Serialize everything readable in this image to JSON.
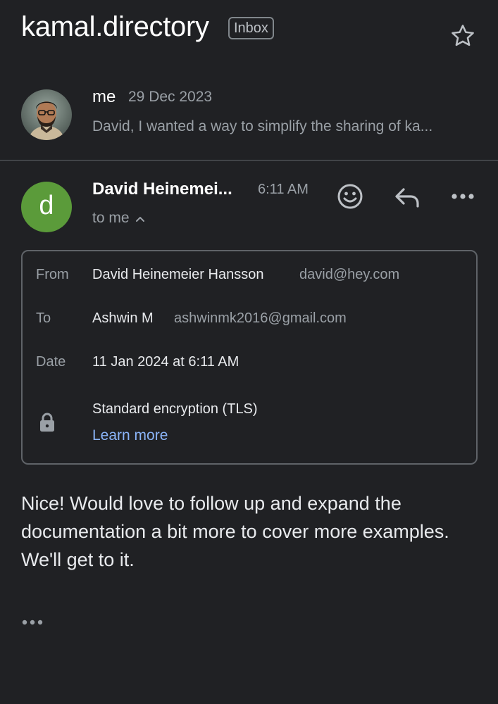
{
  "thread": {
    "subject": "kamal.directory",
    "label_badge": "Inbox",
    "star_icon": "star-outline-icon"
  },
  "previous_message": {
    "sender": "me",
    "date": "29 Dec 2023",
    "snippet": "David, I wanted a way to simplify the sharing of ka..."
  },
  "message": {
    "avatar_letter": "d",
    "avatar_color": "#5b9b3a",
    "sender": "David Heinemei...",
    "time": "6:11 AM",
    "to": "to me",
    "actions": [
      "emoji-react-icon",
      "reply-icon",
      "more-options-icon"
    ],
    "details": {
      "from_label": "From",
      "from_name": "David Heinemeier Hansson",
      "from_email": "david@hey.com",
      "to_label": "To",
      "to_name": "Ashwin M",
      "to_email": "ashwinmk2016@gmail.com",
      "date_label": "Date",
      "date_value": "11 Jan 2024 at 6:11 AM",
      "encryption": "Standard encryption (TLS)",
      "learn_more": "Learn more"
    },
    "body": "Nice! Would love to follow up and expand the documentation a bit more to cover more examples. We'll get to it."
  },
  "colors": {
    "background": "#202124",
    "link": "#8ab4f8",
    "muted": "#9aa0a6"
  }
}
